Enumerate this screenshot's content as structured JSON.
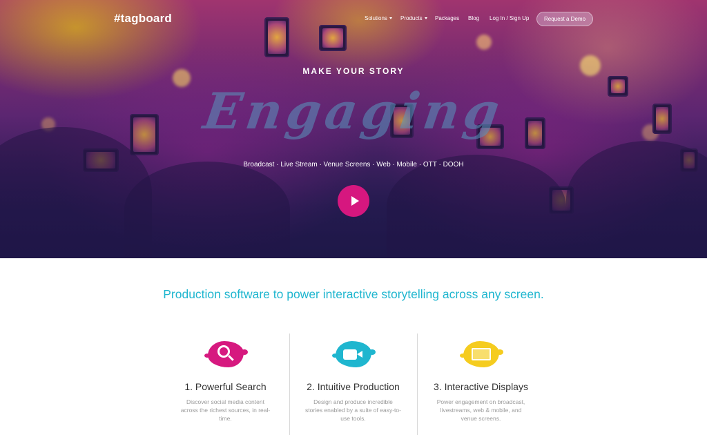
{
  "nav": {
    "logo": "#tagboard",
    "items": [
      {
        "label": "Solutions",
        "has_dropdown": true
      },
      {
        "label": "Products",
        "has_dropdown": true
      },
      {
        "label": "Packages",
        "has_dropdown": false
      },
      {
        "label": "Blog",
        "has_dropdown": false
      },
      {
        "label": "Log In / Sign Up",
        "has_dropdown": false
      }
    ],
    "cta": "Request a Demo"
  },
  "hero": {
    "kicker": "MAKE YOUR STORY",
    "script_word": "Engaging",
    "channels": "Broadcast · Live Stream · Venue Screens · Web · Mobile · OTT · DOOH",
    "play_icon": "play-icon"
  },
  "main": {
    "tagline": "Production software to power interactive storytelling across any screen.",
    "features": [
      {
        "title": "1. Powerful Search",
        "text": "Discover social media content across the richest sources, in real-time.",
        "icon": "search-icon",
        "color": "#d6197f"
      },
      {
        "title": "2. Intuitive Production",
        "text": "Design and produce incredible stories enabled by a suite of easy-to-use tools.",
        "icon": "video-camera-icon",
        "color": "#1fb6cf"
      },
      {
        "title": "3. Interactive Displays",
        "text": "Power engagement on broadcast, livestreams, web & mobile, and venue screens.",
        "icon": "display-icon",
        "color": "#f5cc1f"
      }
    ]
  },
  "colors": {
    "accent_cyan": "#1fb6cf",
    "accent_magenta": "#d6177f",
    "accent_yellow": "#f5cc1f"
  }
}
